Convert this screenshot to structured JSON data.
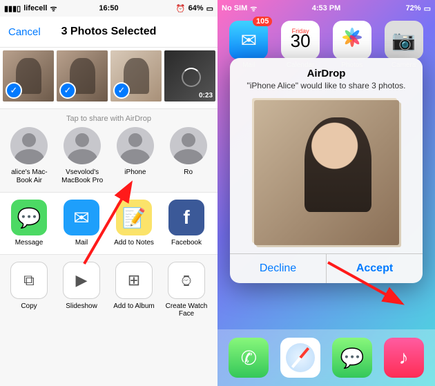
{
  "left": {
    "status": {
      "carrier": "lifecell",
      "time": "16:50",
      "battery": "64%"
    },
    "nav": {
      "cancel": "Cancel",
      "title": "3 Photos Selected"
    },
    "thumbs": [
      {
        "selected": true
      },
      {
        "selected": true
      },
      {
        "selected": true
      },
      {
        "selected": false,
        "video": true,
        "duration": "0:23",
        "loading": true
      },
      {
        "selected": false
      }
    ],
    "airdrop_hint": "Tap to share with AirDrop",
    "airdrop_targets": [
      {
        "label": "alice's Mac-\nBook Air"
      },
      {
        "label": "Vsevolod's\nMacBook Pro"
      },
      {
        "label": "iPhone"
      },
      {
        "label": "Ro"
      }
    ],
    "share_apps": [
      {
        "label": "Message",
        "icon": "message-icon"
      },
      {
        "label": "Mail",
        "icon": "mail-icon"
      },
      {
        "label": "Add to Notes",
        "icon": "notes-icon"
      },
      {
        "label": "Facebook",
        "icon": "facebook-icon"
      }
    ],
    "actions": [
      {
        "label": "Copy",
        "icon": "copy-icon"
      },
      {
        "label": "Slideshow",
        "icon": "slideshow-icon"
      },
      {
        "label": "Add to Album",
        "icon": "add-album-icon"
      },
      {
        "label": "Create\nWatch Face",
        "icon": "watchface-icon"
      }
    ]
  },
  "right": {
    "status": {
      "carrier": "No SIM",
      "time": "4:53 PM",
      "battery": "72%"
    },
    "apps_row1": [
      {
        "label": "Mail",
        "badge": "105"
      },
      {
        "label": "Calendar",
        "cal_day": "Friday",
        "cal_num": "30"
      },
      {
        "label": "Photos"
      },
      {
        "label": "Camera"
      }
    ],
    "dialog": {
      "title": "AirDrop",
      "subtitle": "\"iPhone Alice\" would like to share 3 photos.",
      "decline": "Decline",
      "accept": "Accept"
    },
    "dock": [
      {
        "name": "phone-app"
      },
      {
        "name": "safari-app"
      },
      {
        "name": "messages-app"
      },
      {
        "name": "music-app"
      }
    ]
  }
}
